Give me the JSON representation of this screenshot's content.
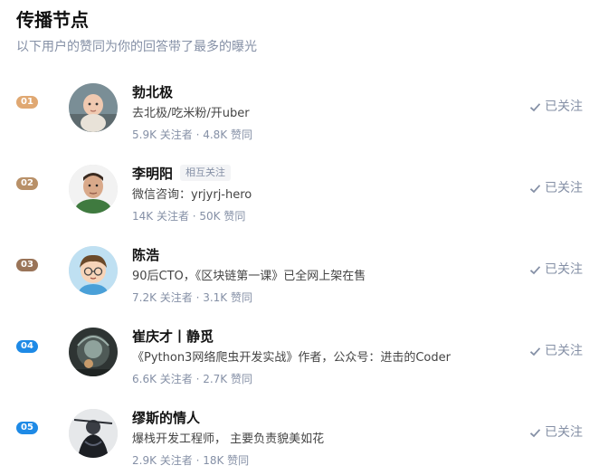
{
  "header": {
    "title": "传播节点",
    "subtitle": "以下用户的赞同为你的回答带了最多的曝光"
  },
  "colors": {
    "rank_gold": "#e0a872",
    "rank_bronze": "#b38e6c",
    "rank_brown": "#9c7759",
    "rank_blue": "#2a8ee0",
    "muted": "#8590a6"
  },
  "users": [
    {
      "rank": "01",
      "rank_color": "#e0a872",
      "name": "勃北极",
      "mutual": "",
      "bio": "去北极/吃米粉/开uber",
      "stats": "5.9K 关注者 · 4.8K 赞同",
      "follow_label": "已关注",
      "avatar_icon": "baby-photo-icon"
    },
    {
      "rank": "02",
      "rank_color": "#b89068",
      "name": "李明阳",
      "mutual": "相互关注",
      "bio": "微信咨询：yrjyrj-hero",
      "stats": "14K 关注者 · 50K 赞同",
      "follow_label": "已关注",
      "avatar_icon": "man-portrait-icon"
    },
    {
      "rank": "03",
      "rank_color": "#9a7458",
      "name": "陈浩",
      "mutual": "",
      "bio": "90后CTO，《区块链第一课》已全网上架在售",
      "stats": "7.2K 关注者 · 3.1K 赞同",
      "follow_label": "已关注",
      "avatar_icon": "cartoon-avatar-icon"
    },
    {
      "rank": "04",
      "rank_color": "#1e8ae6",
      "name": "崔庆才丨静觅",
      "mutual": "",
      "bio": "《Python3网络爬虫开发实战》作者，公众号：进击的Coder",
      "stats": "6.6K 关注者 · 2.7K 赞同",
      "follow_label": "已关注",
      "avatar_icon": "dark-figure-icon"
    },
    {
      "rank": "05",
      "rank_color": "#1e8ae6",
      "name": "缪斯的情人",
      "mutual": "",
      "bio": "爆栈开发工程师， 主要负责貌美如花",
      "stats": "2.9K 关注者 · 18K 赞同",
      "follow_label": "已关注",
      "avatar_icon": "swordsman-icon"
    }
  ]
}
